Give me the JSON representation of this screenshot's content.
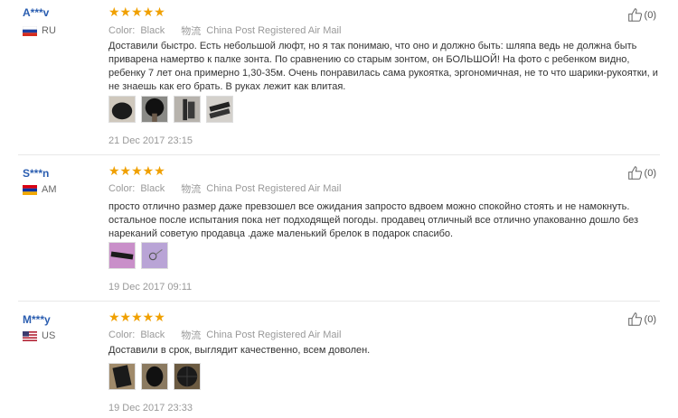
{
  "reviews": [
    {
      "user": "A***v",
      "country": "RU",
      "rating_value": 5,
      "stars": "★★★★★",
      "color_label": "Color:",
      "color_value": "Black",
      "shipping_label": "China Post Registered Air Mail",
      "helpful_count": "(0)",
      "text": "Доставили быстро. Есть небольшой люфт, но я так понимаю, что оно и должно быть: шляпа ведь не должна быть приварена намертво к палке зонта. По сравнению со старым зонтом, он БОЛЬШОЙ! На фото с ребенком видно, ребенку 7 лет она примерно 1,30-35м. Очень понравилась сама рукоятка, эргономичная, не то что шарики-рукоятки, и не знаешь как его брать. В руках лежит как влитая.",
      "date": "21 Dec 2017 23:15",
      "photos": [
        "photo-umbrella-open",
        "photo-umbrella-child",
        "photo-umbrella-handle",
        "photo-umbrella-closed"
      ]
    },
    {
      "user": "S***n",
      "country": "AM",
      "rating_value": 5,
      "stars": "★★★★★",
      "color_label": "Color:",
      "color_value": "Black",
      "shipping_label": "China Post Registered Air Mail",
      "helpful_count": "(0)",
      "text": "просто отлично размер даже превзошел все ожидания запросто вдвоем можно спокойно стоять и не намокнуть. остальное после испытания пока нет подходящей погоды. продавец отличный все отлично упакованно дошло без нареканий советую продавца .даже маленький брелок в подарок спасибо.",
      "date": "19 Dec 2017 09:11",
      "photos": [
        "photo-umbrella-folded",
        "photo-keychain"
      ]
    },
    {
      "user": "M***y",
      "country": "US",
      "rating_value": 5,
      "stars": "★★★★★",
      "color_label": "Color:",
      "color_value": "Black",
      "shipping_label": "China Post Registered Air Mail",
      "helpful_count": "(0)",
      "text": "Доставили в срок, выглядит качественно, всем доволен.",
      "date": "19 Dec 2017 23:33",
      "photos": [
        "photo-umbrella-top",
        "photo-umbrella-side",
        "photo-umbrella-canopy"
      ]
    }
  ],
  "colors": {
    "star": "#f0a000",
    "user_link": "#2a5db0",
    "muted": "#999999",
    "text": "#333333"
  }
}
